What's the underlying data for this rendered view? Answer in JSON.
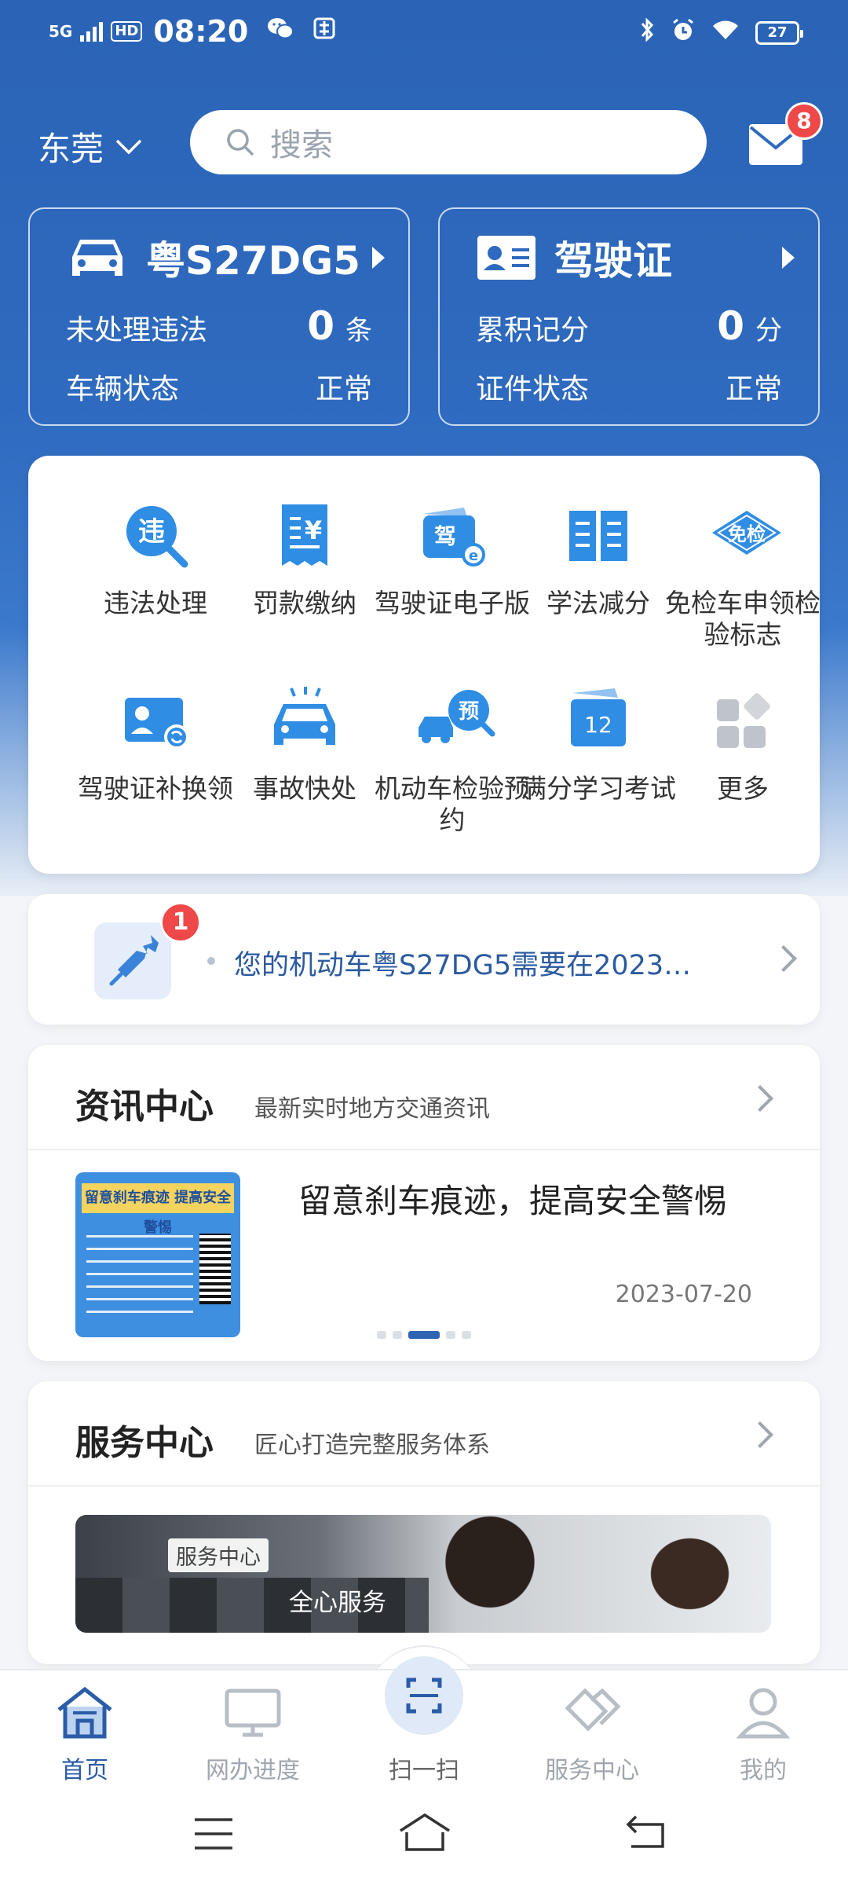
{
  "status_bar": {
    "network": "5G",
    "hd": "HD",
    "time": "08:20",
    "battery": "27"
  },
  "header": {
    "city": "东莞",
    "search_placeholder": "搜索",
    "mail_badge": "8"
  },
  "vehicle_card": {
    "plate": "粤S27DG5",
    "row1_label": "未处理违法",
    "row1_value": "0",
    "row1_unit": "条",
    "row2_label": "车辆状态",
    "row2_value": "正常"
  },
  "license_card": {
    "title": "驾驶证",
    "row1_label": "累积记分",
    "row1_value": "0",
    "row1_unit": "分",
    "row2_label": "证件状态",
    "row2_value": "正常"
  },
  "services": [
    {
      "label": "违法处理",
      "icon": "violation-icon",
      "glyph": "违"
    },
    {
      "label": "罚款缴纳",
      "icon": "fine-receipt-icon",
      "glyph": "¥"
    },
    {
      "label": "驾驶证电子版",
      "icon": "e-license-icon",
      "glyph": "驾"
    },
    {
      "label": "学法减分",
      "icon": "book-icon",
      "glyph": ""
    },
    {
      "label": "免检车申领检验标志",
      "icon": "exempt-inspection-icon",
      "glyph": "免检"
    },
    {
      "label": "驾驶证补换领",
      "icon": "license-replace-icon",
      "glyph": ""
    },
    {
      "label": "事故快处",
      "icon": "accident-icon",
      "glyph": ""
    },
    {
      "label": "机动车检验预约",
      "icon": "inspection-appointment-icon",
      "glyph": "预"
    },
    {
      "label": "满分学习考试",
      "icon": "calendar-exam-icon",
      "glyph": "12"
    },
    {
      "label": "更多",
      "icon": "more-grid-icon",
      "glyph": ""
    }
  ],
  "notice": {
    "badge": "1",
    "text": "您的机动车粤S27DG5需要在2023…"
  },
  "news_section": {
    "title": "资讯中心",
    "subtitle": "最新实时地方交通资讯",
    "image_caption": "留意刹车痕迹  提高安全警惕",
    "article_title": "留意刹车痕迹，提高安全警惕",
    "date": "2023-07-20"
  },
  "service_section": {
    "title": "服务中心",
    "subtitle": "匠心打造完整服务体系",
    "banner_tag": "服务中心",
    "banner_text": "全心服务"
  },
  "tabs": [
    {
      "label": "首页",
      "icon": "home-icon",
      "active": true
    },
    {
      "label": "网办进度",
      "icon": "monitor-icon",
      "active": false
    },
    {
      "label": "扫一扫",
      "icon": "scan-icon",
      "active": false
    },
    {
      "label": "服务中心",
      "icon": "handshake-icon",
      "active": false
    },
    {
      "label": "我的",
      "icon": "user-icon",
      "active": false
    }
  ],
  "colors": {
    "brand_blue": "#2e64b3",
    "badge_red": "#ef4848",
    "icon_blue": "#2f8de4"
  }
}
